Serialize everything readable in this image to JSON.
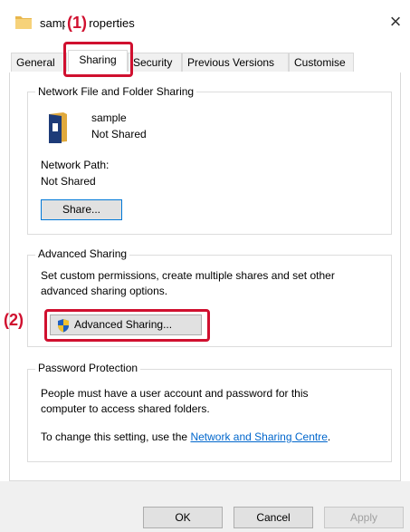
{
  "window": {
    "title": "sample Properties",
    "close_label": "×"
  },
  "annotations": {
    "step1": "(1)",
    "step2": "(2)"
  },
  "tabs": [
    {
      "label": "General"
    },
    {
      "label": "Sharing"
    },
    {
      "label": "Security"
    },
    {
      "label": "Previous Versions"
    },
    {
      "label": "Customise"
    }
  ],
  "network_sharing": {
    "group_label": "Network File and Folder Sharing",
    "folder_name": "sample",
    "share_status": "Not Shared",
    "path_label": "Network Path:",
    "path_value": "Not Shared",
    "share_button": "Share..."
  },
  "advanced_sharing": {
    "group_label": "Advanced Sharing",
    "description_line1": "Set custom permissions, create multiple shares and set other",
    "description_line2": "advanced sharing options.",
    "button_label": "Advanced Sharing..."
  },
  "password_protection": {
    "group_label": "Password Protection",
    "text_line1": "People must have a user account and password for this",
    "text_line2": "computer to access shared folders.",
    "change_prefix": "To change this setting, use the ",
    "link_text": "Network and Sharing Centre",
    "change_suffix": "."
  },
  "footer": {
    "ok": "OK",
    "cancel": "Cancel",
    "apply": "Apply"
  },
  "colors": {
    "annotation_red": "#d0102f",
    "link_blue": "#0066cc",
    "focus_blue": "#0078d7"
  }
}
